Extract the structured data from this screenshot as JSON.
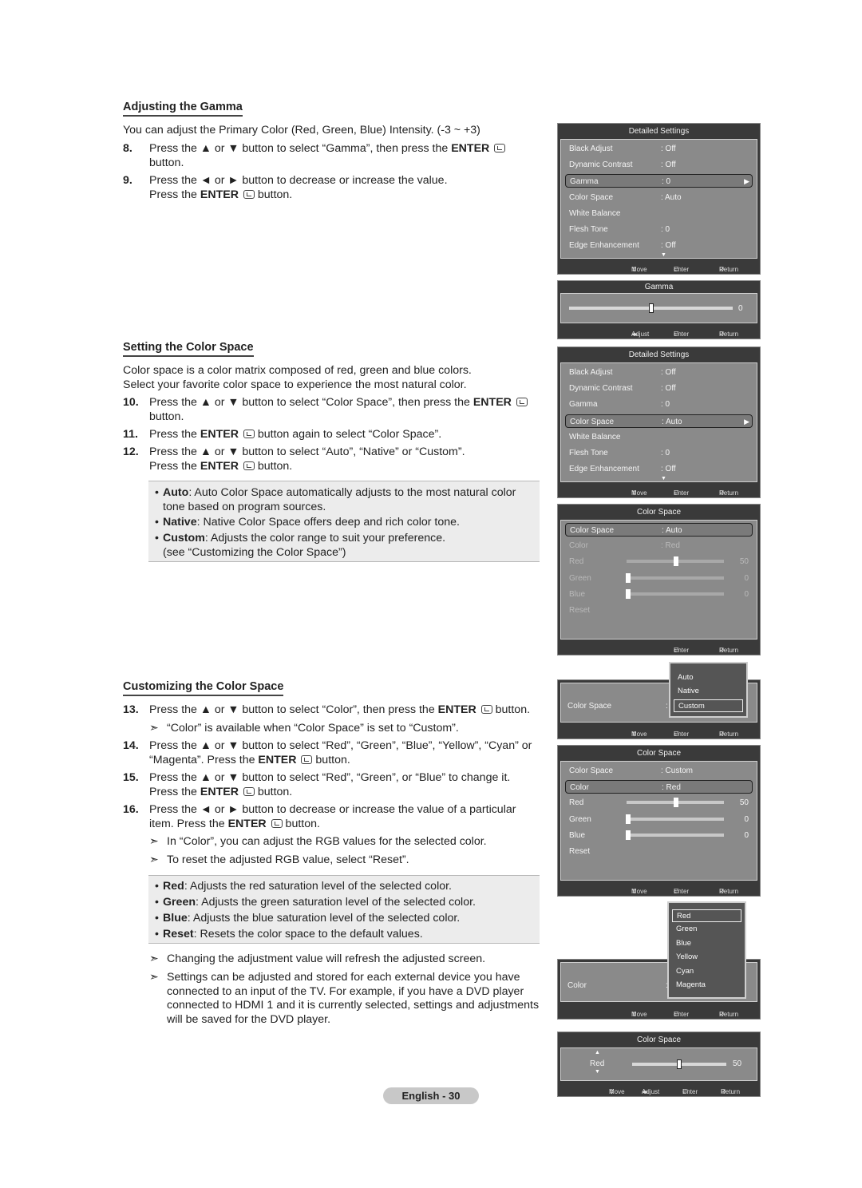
{
  "sections": {
    "gamma": {
      "heading": "Adjusting the Gamma",
      "intro": "You can adjust the Primary Color (Red, Green, Blue) Intensity. (-3 ~ +3)",
      "steps": [
        {
          "num": "8.",
          "line1": "Press the ▲ or ▼ button to select “Gamma”, then press the ",
          "bold": "ENTER",
          "line1_end": "",
          "line2": "button."
        },
        {
          "num": "9.",
          "line1": "Press the ◄ or ► button to decrease or increase the value.",
          "line2_pre": "Press the ",
          "bold": "ENTER",
          "line2_post": " button."
        }
      ]
    },
    "color_space": {
      "heading": "Setting the Color Space",
      "intro1": "Color space is a color matrix composed of red, green and blue colors.",
      "intro2": "Select your favorite color space to experience the most natural color.",
      "steps": [
        {
          "num": "10.",
          "line1": "Press the ▲ or ▼ button to select “Color Space”, then press the ",
          "bold": "ENTER",
          "line2": "button."
        },
        {
          "num": "11.",
          "pre": "Press the ",
          "bold": "ENTER",
          "post": " button again to select “Color Space”."
        },
        {
          "num": "12.",
          "line1": "Press the ▲ or ▼ button to select “Auto”, “Native” or “Custom”.",
          "line2_pre": "Press the ",
          "bold": "ENTER",
          "line2_post": " button."
        }
      ],
      "bullets": [
        {
          "term": "Auto",
          "text": ": Auto Color Space automatically adjusts to the most natural color",
          "text2": "tone based on program sources."
        },
        {
          "term": "Native",
          "text": ": Native Color Space offers deep and rich color tone."
        },
        {
          "term": "Custom",
          "text": ": Adjusts the color range to suit your preference.",
          "text2": "(see “Customizing the Color Space”)"
        }
      ]
    },
    "customizing": {
      "heading": "Customizing the Color Space",
      "steps": [
        {
          "num": "13.",
          "pre": "Press the ▲ or ▼ button to select “Color”, then press the ",
          "bold": "ENTER",
          "post": " button."
        },
        {
          "num": "14.",
          "line1": "Press the ▲ or ▼ button to select “Red”, “Green”, “Blue”, “Yellow”, “Cyan” or",
          "line2_pre": "“Magenta”. Press the ",
          "bold": "ENTER",
          "line2_post": " button."
        },
        {
          "num": "15.",
          "line1": "Press the ▲ or ▼ button to select “Red”, “Green”, or “Blue” to change it.",
          "line2_pre": "Press the ",
          "bold": "ENTER",
          "line2_post": " button."
        },
        {
          "num": "16.",
          "line1": "Press the ◄ or ► button to decrease or increase the value of a particular",
          "line2_pre": "item. Press the ",
          "bold": "ENTER",
          "line2_post": " button."
        }
      ],
      "note_13": "“Color” is available when “Color Space” is set to “Custom”.",
      "notes_16": [
        "In “Color”, you can adjust the RGB values for the selected color.",
        "To reset the adjusted RGB value, select “Reset”."
      ],
      "bullets": [
        {
          "term": "Red",
          "text": ": Adjusts the red saturation level of the selected color."
        },
        {
          "term": "Green",
          "text": ": Adjusts the green saturation level of the selected color."
        },
        {
          "term": "Blue",
          "text": ": Adjusts the blue saturation level of the selected color."
        },
        {
          "term": "Reset",
          "text": ": Resets the color space to the default values."
        }
      ],
      "closing_notes": [
        {
          "lines": [
            "Changing the adjustment value will refresh the adjusted screen."
          ]
        },
        {
          "lines": [
            "Settings can be adjusted and stored for each external device you have",
            "connected to an input of the TV. For example, if you have a DVD player",
            "connected to HDMI 1 and it is currently selected, settings and adjustments",
            "will be saved for the DVD player."
          ]
        }
      ]
    }
  },
  "glyphs": {
    "arrow": "➣",
    "bullet": "•"
  },
  "page_label": "English - 30",
  "footer": {
    "move": "Move",
    "enter": "Enter",
    "return": "Return",
    "adjust": "Adjust"
  },
  "osd": {
    "detailed_settings_1": {
      "title": "Detailed Settings",
      "selected_index": 2,
      "rows": [
        {
          "label": "Black Adjust",
          "value": ": Off"
        },
        {
          "label": "Dynamic Contrast",
          "value": ": Off"
        },
        {
          "label": "Gamma",
          "value": ": 0"
        },
        {
          "label": "Color Space",
          "value": ": Auto"
        },
        {
          "label": "White Balance",
          "value": ""
        },
        {
          "label": "Flesh Tone",
          "value": ": 0"
        },
        {
          "label": "Edge Enhancement",
          "value": ": Off"
        }
      ]
    },
    "gamma_slider": {
      "title": "Gamma",
      "value": "0",
      "range": [
        -3,
        3
      ],
      "current": 0
    },
    "detailed_settings_2": {
      "title": "Detailed Settings",
      "selected_index": 3,
      "rows": [
        {
          "label": "Black Adjust",
          "value": ": Off"
        },
        {
          "label": "Dynamic Contrast",
          "value": ": Off"
        },
        {
          "label": "Gamma",
          "value": ": 0"
        },
        {
          "label": "Color Space",
          "value": ": Auto"
        },
        {
          "label": "White Balance",
          "value": ""
        },
        {
          "label": "Flesh Tone",
          "value": ": 0"
        },
        {
          "label": "Edge Enhancement",
          "value": ": Off"
        }
      ]
    },
    "color_space_1": {
      "title": "Color Space",
      "rows": [
        {
          "label": "Color Space",
          "value": ": Auto"
        },
        {
          "label": "Color",
          "value": ": Red"
        }
      ],
      "sliders": [
        {
          "label": "Red",
          "value": "50",
          "fraction": 0.5
        },
        {
          "label": "Green",
          "value": "0",
          "fraction": 0
        },
        {
          "label": "Blue",
          "value": "0",
          "fraction": 0
        }
      ],
      "reset": "Reset"
    },
    "color_space_popup": {
      "label": "Color Space",
      "colon": ":",
      "options": [
        "Auto",
        "Native",
        "Custom"
      ],
      "selected": 2
    },
    "color_space_2": {
      "title": "Color Space",
      "rows": [
        {
          "label": "Color Space",
          "value": ": Custom"
        },
        {
          "label": "Color",
          "value": ": Red"
        }
      ],
      "sliders": [
        {
          "label": "Red",
          "value": "50",
          "fraction": 0.5
        },
        {
          "label": "Green",
          "value": "0",
          "fraction": 0
        },
        {
          "label": "Blue",
          "value": "0",
          "fraction": 0
        }
      ],
      "reset": "Reset"
    },
    "color_popup": {
      "label": "Color",
      "colon": ":",
      "options": [
        "Red",
        "Green",
        "Blue",
        "Yellow",
        "Cyan",
        "Magenta"
      ],
      "selected": 0
    },
    "red_slider": {
      "title": "Color Space",
      "label": "Red",
      "value": "50",
      "fraction": 0.5
    }
  }
}
